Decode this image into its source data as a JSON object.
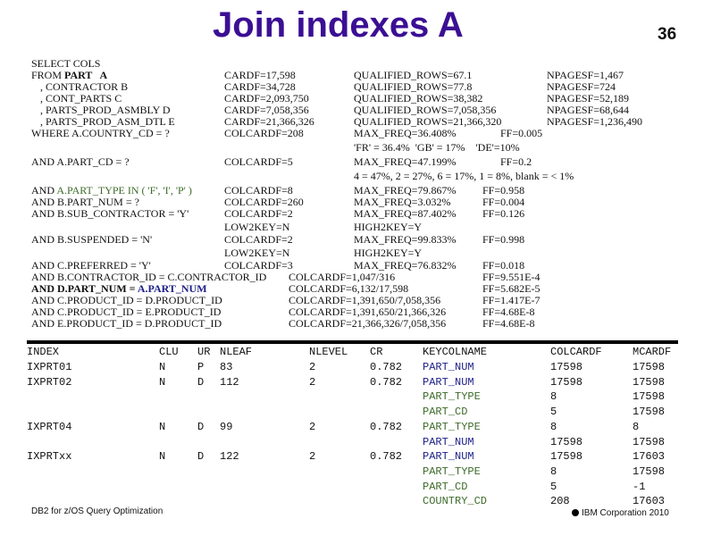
{
  "slide": {
    "title": "Join indexes A",
    "page_number": "36",
    "footer_left": "DB2 for z/OS Query Optimization",
    "footer_right": "IBM Corporation 2010",
    "colors": {
      "title": "#3b0f94",
      "predicate_green": "#3d6b2a",
      "join_navy": "#1c1e86"
    }
  },
  "sql": {
    "lines": [
      "SELECT COLS",
      "FROM ",
      ", CONTRACTOR B",
      ", CONT_PARTS C",
      ", PARTS_PROD_ASMBLY D",
      ", PARTS_PROD_ASM_DTL E",
      "WHERE A.COUNTRY_CD = ?",
      "AND A.PART_CD = ?",
      "AND ",
      "AND B.PART_NUM = ?",
      "AND B.SUB_CONTRACTOR = 'Y'",
      "AND B.SUSPENDED = 'N'",
      "AND C.PREFERRED = 'Y'",
      "AND B.CONTRACTOR_ID = C.CONTRACTOR_ID",
      "AND D.PART_NUM = ",
      "AND C.PRODUCT_ID = D.PRODUCT_ID",
      "AND C.PRODUCT_ID = E.PRODUCT_ID",
      "AND E.PRODUCT_ID = D.PRODUCT_ID"
    ],
    "from_table": "PART   A",
    "part_type_pred": "A.PART_TYPE IN ( 'F', 'I', 'P' )",
    "join_rhs": "A.PART_NUM"
  },
  "stats": {
    "cardf": [
      "CARDF=17,598",
      "CARDF=34,728",
      "CARDF=2,093,750",
      "CARDF=7,058,356",
      "CARDF=21,366,326",
      "COLCARDF=208",
      "COLCARDF=5",
      "COLCARDF=8",
      "COLCARDF=260",
      "COLCARDF=2",
      "LOW2KEY=N",
      "COLCARDF=2",
      "LOW2KEY=N",
      "COLCARDF=3"
    ],
    "join_colcardf": [
      "COLCARDF=1,047/316",
      "COLCARDF=6,132/17,598",
      "COLCARDF=1,391,650/7,058,356",
      "COLCARDF=1,391,650/21,366,326",
      "COLCARDF=21,366,326/7,058,356"
    ],
    "qualified": [
      "QUALIFIED_ROWS=67.1",
      "QUALIFIED_ROWS=77.8",
      "QUALIFIED_ROWS=38,382",
      "QUALIFIED_ROWS=7,058,356",
      "QUALIFIED_ROWS=21,366,320",
      "MAX_FREQ=36.408%",
      "'FR' = 36.4%  'GB' = 17%    'DE'=10%",
      "MAX_FREQ=47.199%",
      "4 = 47%, 2 = 27%, 6 = 17%, 1 = 8%, blank = < 1%",
      "MAX_FREQ=79.867%",
      "MAX_FREQ=3.032%",
      "MAX_FREQ=87.402%",
      "HIGH2KEY=Y",
      "MAX_FREQ=99.833%",
      "HIGH2KEY=Y",
      "MAX_FREQ=76.832%"
    ],
    "ff": [
      "FF=0.005",
      "FF=0.2",
      "FF=0.958",
      "FF=0.004",
      "FF=0.126",
      "FF=0.998",
      "FF=0.018",
      "FF=9.551E-4",
      "FF=5.682E-5",
      "FF=1.417E-7",
      "FF=4.68E-8",
      "FF=4.68E-8"
    ],
    "npagesf": [
      "NPAGESF=1,467",
      "NPAGESF=724",
      "NPAGESF=52,189",
      "NPAGESF=68,644",
      "NPAGESF=1,236,490"
    ]
  },
  "index_table": {
    "headers": [
      "INDEX",
      "CLU",
      "UR",
      "NLEAF",
      "NLEVEL",
      "CR",
      "KEYCOLNAME",
      "COLCARDF",
      "MCARDF"
    ],
    "rows": [
      {
        "index": "IXPRT01",
        "clu": "N",
        "ur": "P",
        "nleaf": "83",
        "nlevel": "2",
        "cr": "0.782",
        "keys": [
          {
            "name": "PART_NUM",
            "color": "navy",
            "colcardf": "17598",
            "mcardf": "17598"
          }
        ]
      },
      {
        "index": "IXPRT02",
        "clu": "N",
        "ur": "D",
        "nleaf": "112",
        "nlevel": "2",
        "cr": "0.782",
        "keys": [
          {
            "name": "PART_NUM",
            "color": "navy",
            "colcardf": "17598",
            "mcardf": "17598"
          },
          {
            "name": "PART_TYPE",
            "color": "green",
            "colcardf": "8",
            "mcardf": "17598"
          },
          {
            "name": "PART_CD",
            "color": "green",
            "colcardf": "5",
            "mcardf": "17598"
          }
        ]
      },
      {
        "index": "IXPRT04",
        "clu": "N",
        "ur": "D",
        "nleaf": "99",
        "nlevel": "2",
        "cr": "0.782",
        "keys": [
          {
            "name": "PART_TYPE",
            "color": "green",
            "colcardf": "8",
            "mcardf": "8"
          },
          {
            "name": "PART_NUM",
            "color": "navy",
            "colcardf": "17598",
            "mcardf": "17598"
          }
        ]
      },
      {
        "index": "IXPRTxx",
        "clu": "N",
        "ur": "D",
        "nleaf": "122",
        "nlevel": "2",
        "cr": "0.782",
        "keys": [
          {
            "name": "PART_NUM",
            "color": "navy",
            "colcardf": "17598",
            "mcardf": "17603"
          },
          {
            "name": "PART_TYPE",
            "color": "green",
            "colcardf": "8",
            "mcardf": "17598"
          },
          {
            "name": "PART_CD",
            "color": "green",
            "colcardf": "5",
            "mcardf": "-1"
          },
          {
            "name": "COUNTRY_CD",
            "color": "green",
            "colcardf": "208",
            "mcardf": "17603"
          }
        ]
      }
    ]
  }
}
